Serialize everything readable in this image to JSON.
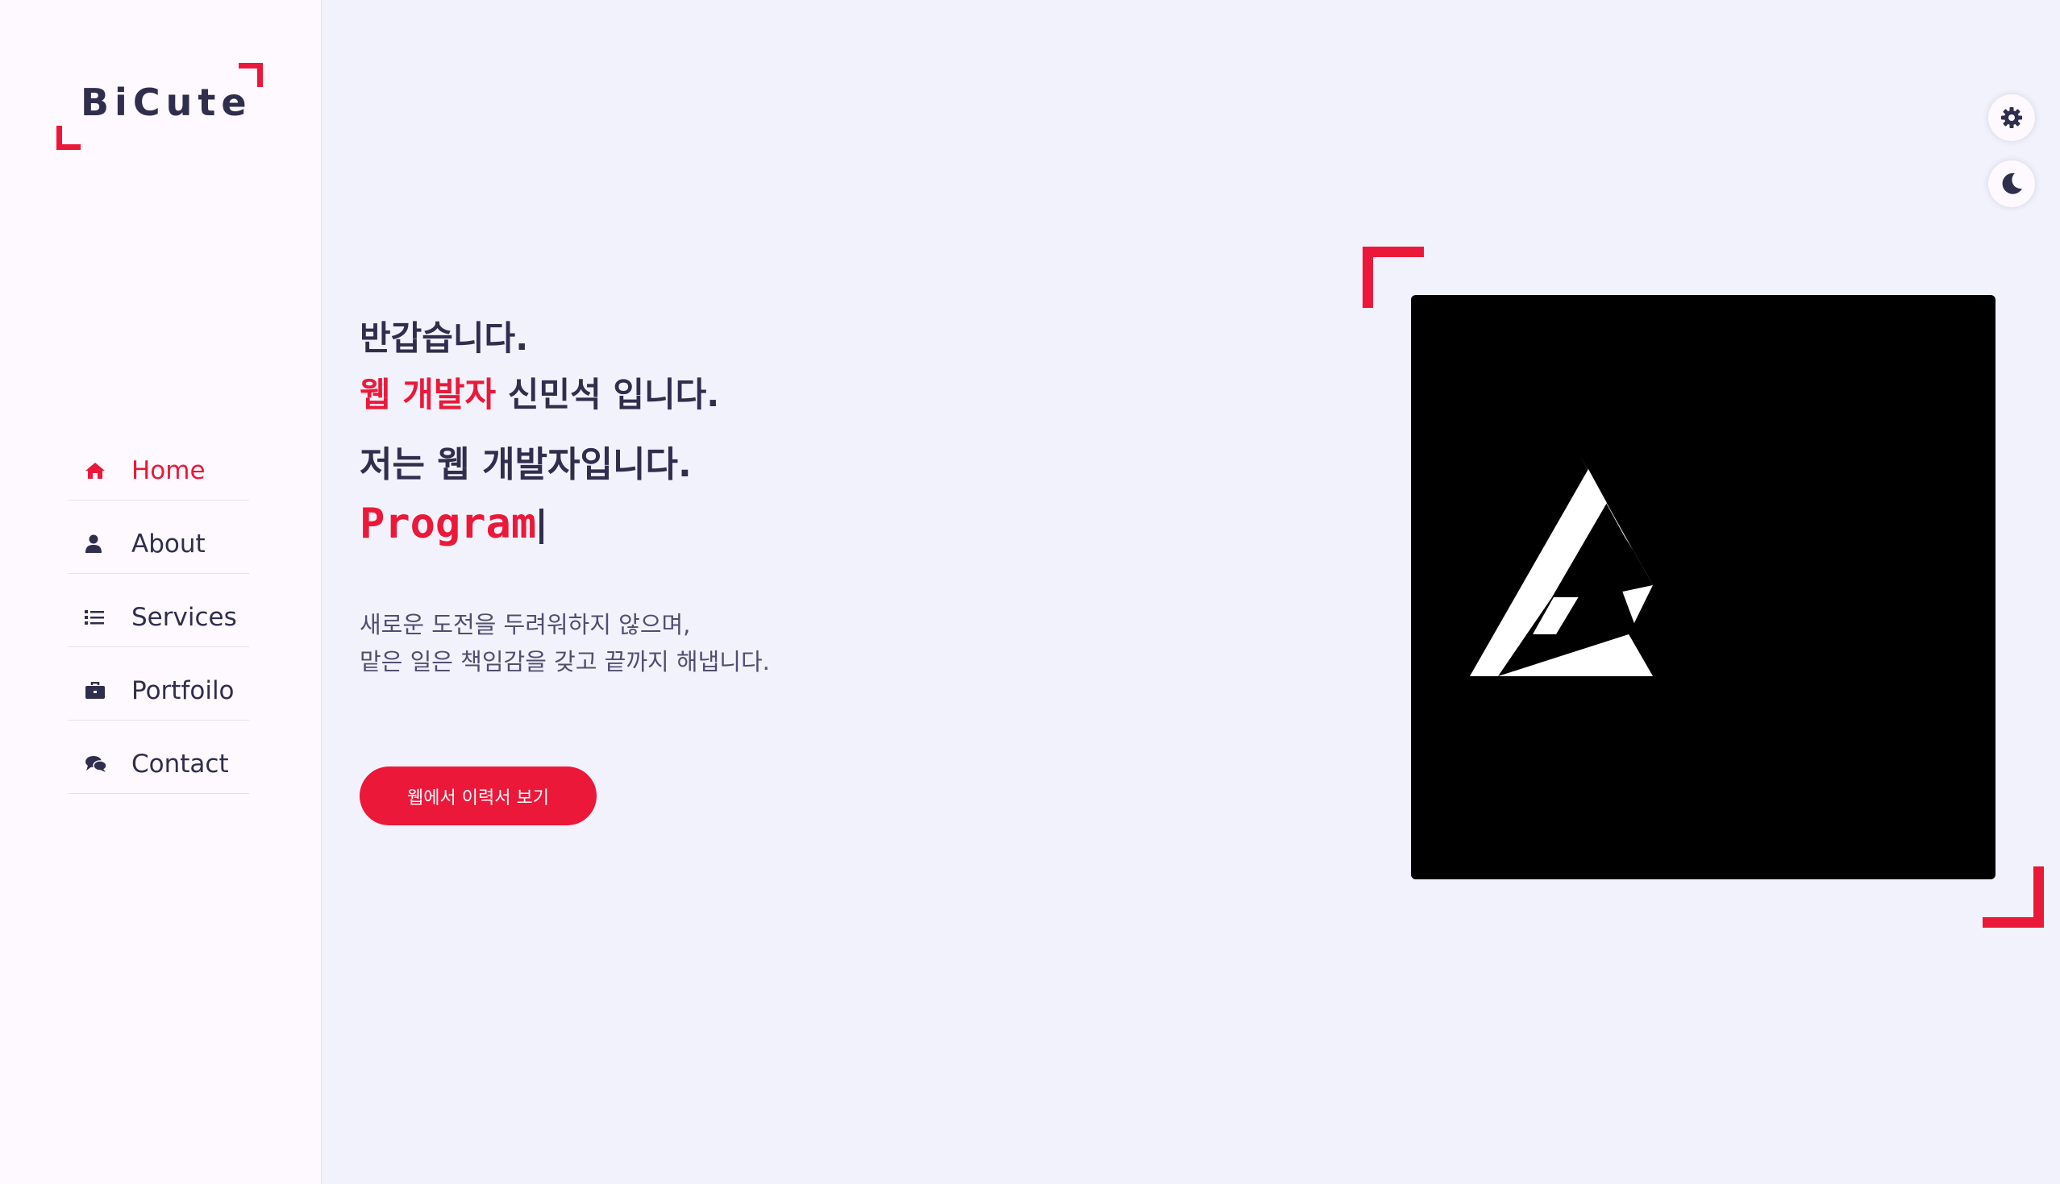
{
  "logo": {
    "text": "BiCute"
  },
  "nav": {
    "items": [
      {
        "label": "Home",
        "icon": "home-icon",
        "active": true
      },
      {
        "label": "About",
        "icon": "user-icon",
        "active": false
      },
      {
        "label": "Services",
        "icon": "list-icon",
        "active": false
      },
      {
        "label": "Portfoilo",
        "icon": "briefcase-icon",
        "active": false
      },
      {
        "label": "Contact",
        "icon": "comments-icon",
        "active": false
      }
    ]
  },
  "hero": {
    "greeting": "반갑습니다.",
    "role_accent": "웹 개발자",
    "name_line": " 신민석 입니다.",
    "intro": "저는 웹 개발자입니다.",
    "typed_text": "Program",
    "desc_line1": "새로운 도전을 두려워하지 않으며,",
    "desc_line2": "맡은 일은 책임감을 갖고 끝까지 해냅니다.",
    "cta_label": "웹에서 이력서 보기"
  },
  "toolbar": {
    "settings_icon": "gear-icon",
    "theme_icon": "moon-icon"
  },
  "colors": {
    "accent": "#ec1839",
    "text_dark": "#302e4d",
    "sidebar_bg": "#fdf9ff",
    "page_bg": "#f2f2fc"
  }
}
